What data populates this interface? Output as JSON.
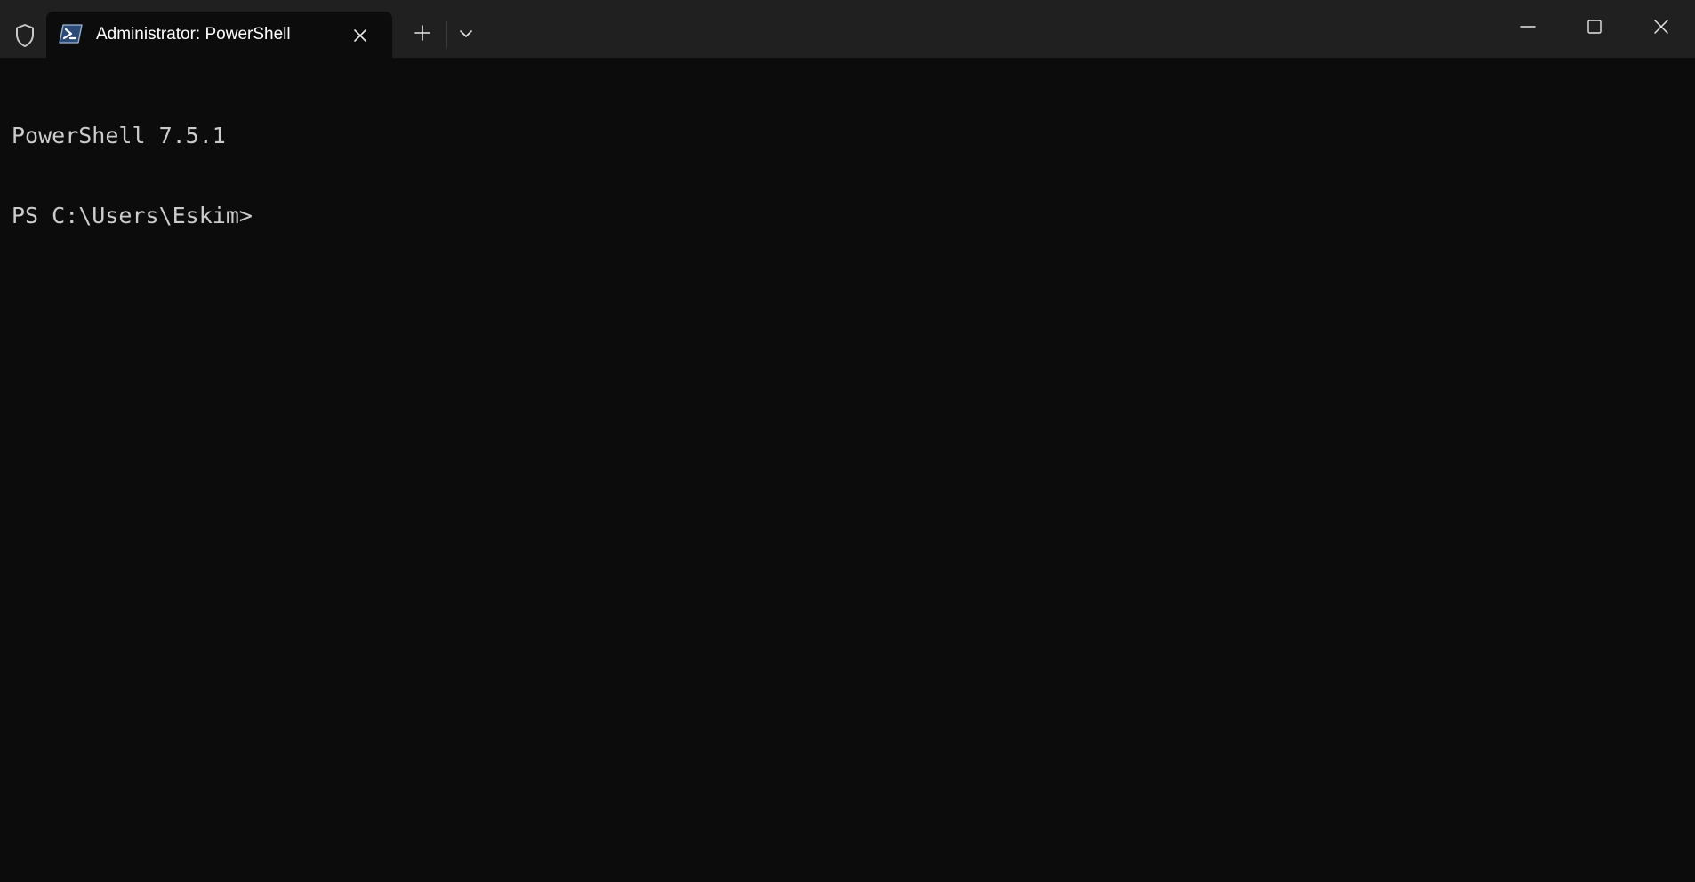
{
  "window": {
    "tab": {
      "title": "Administrator: PowerShell",
      "icon": "powershell-icon"
    },
    "titlebar_icons": {
      "shield": "shield-icon",
      "close_tab": "close-icon",
      "new_tab": "plus-icon",
      "dropdown": "chevron-down-icon",
      "minimize": "minimize-icon",
      "maximize": "maximize-icon",
      "close": "close-icon"
    }
  },
  "terminal": {
    "lines": [
      "PowerShell 7.5.1",
      "PS C:\\Users\\Eskim>"
    ]
  },
  "colors": {
    "titlebar": "#202020",
    "terminal_bg": "#0c0c0c",
    "terminal_text": "#cccccc",
    "tab_text": "#ffffff"
  }
}
